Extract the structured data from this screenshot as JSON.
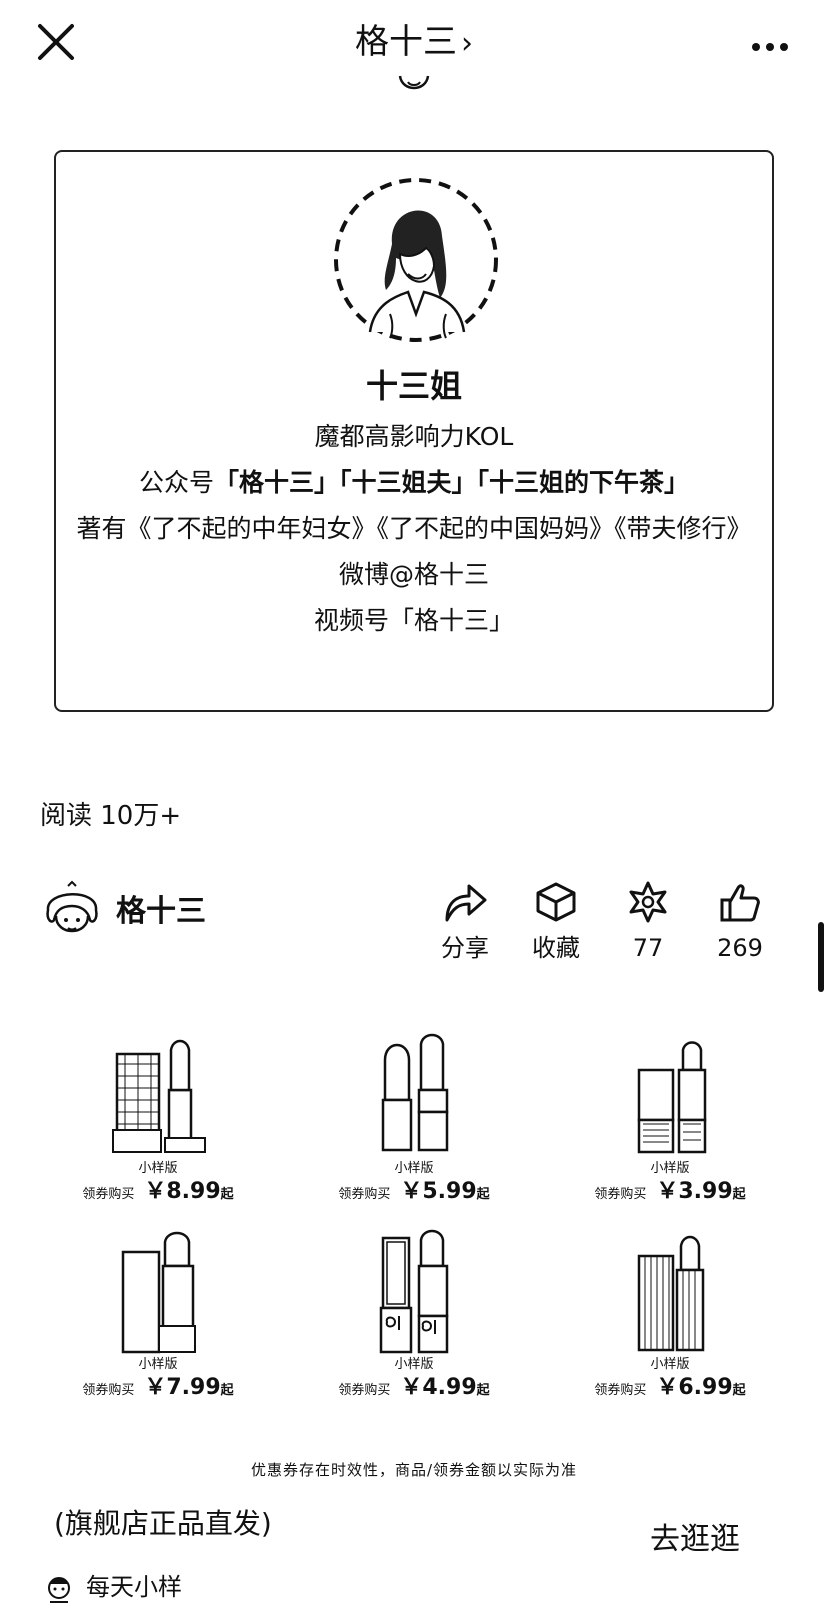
{
  "header": {
    "title": "格十三",
    "title_chevron": "›",
    "close_icon": "close-icon",
    "more_icon": "more-icon"
  },
  "profile_card": {
    "name": "十三姐",
    "tagline": "魔都高影响力KOL",
    "accounts_prefix": "公众号",
    "accounts": "「格十三」「十三姐夫」「十三姐的下午茶」",
    "books": "著有《了不起的中年妇女》《了不起的中国妈妈》《带夫修行》",
    "weibo": "微博@格十三",
    "channel": "视频号「格十三」"
  },
  "stats": {
    "read_count": "阅读 10万+"
  },
  "author": {
    "name": "格十三"
  },
  "actions": [
    {
      "label": "分享",
      "icon": "share-icon"
    },
    {
      "label": "收藏",
      "icon": "cube-icon"
    },
    {
      "label": "77",
      "icon": "star-icon"
    },
    {
      "label": "269",
      "icon": "thumbs-up-icon"
    }
  ],
  "products": [
    {
      "tag": "小样版",
      "coupon": "领券购买",
      "price": "￥8.99",
      "suffix": "起"
    },
    {
      "tag": "小样版",
      "coupon": "领券购买",
      "price": "￥5.99",
      "suffix": "起"
    },
    {
      "tag": "小样版",
      "coupon": "领券购买",
      "price": "￥3.99",
      "suffix": "起"
    },
    {
      "tag": "小样版",
      "coupon": "领券购买",
      "price": "￥7.99",
      "suffix": "起"
    },
    {
      "tag": "小样版",
      "coupon": "领券购买",
      "price": "￥4.99",
      "suffix": "起"
    },
    {
      "tag": "小样版",
      "coupon": "领券购买",
      "price": "￥6.99",
      "suffix": "起"
    }
  ],
  "disclaimer": "优惠券存在时效性，商品/领券金额以实际为准",
  "ad": {
    "title": "(旗舰店正品直发)",
    "cta": "去逛逛",
    "source": "每天小样"
  }
}
